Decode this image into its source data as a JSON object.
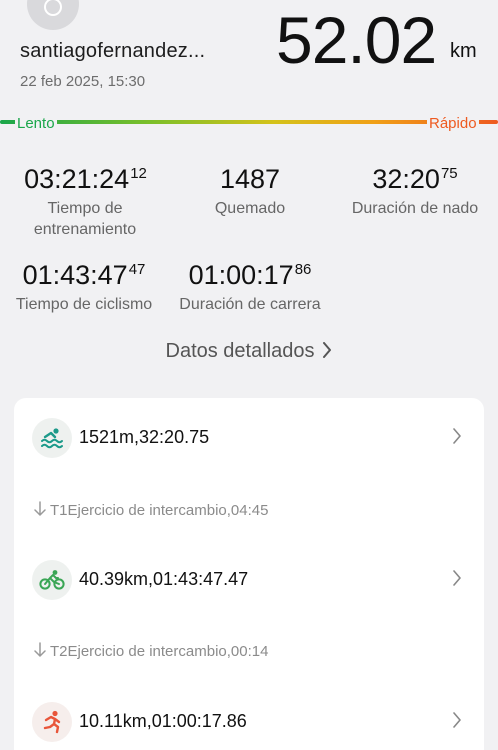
{
  "header": {
    "username": "santiagofernandez...",
    "datetime": "22 feb 2025, 15:30",
    "distance": "52.02",
    "unit": "km"
  },
  "speed_bar": {
    "slow_label": "Lento",
    "fast_label": "Rápido",
    "colors": [
      "#1aa64a",
      "#d4c21a",
      "#ee5a20"
    ]
  },
  "stats": {
    "training_time": {
      "main": "03:21:24",
      "sub": "12",
      "label": "Tiempo de entrenamiento"
    },
    "burned": {
      "main": "1487",
      "label": "Quemado"
    },
    "swim_duration": {
      "main": "32:20",
      "sub": "75",
      "label": "Duración de nado"
    },
    "cycling_time": {
      "main": "01:43:47",
      "sub": "47",
      "label": "Tiempo de ciclismo"
    },
    "run_duration": {
      "main": "01:00:17",
      "sub": "86",
      "label": "Duración de carrera"
    }
  },
  "detailed_link": "Datos detallados",
  "segments": {
    "swim": {
      "text": "1521m,32:20.75",
      "icon": "swim-icon"
    },
    "t1": "T1Ejercicio de intercambio,04:45",
    "bike": {
      "text": "40.39km,01:43:47.47",
      "icon": "bike-icon"
    },
    "t2": "T2Ejercicio de intercambio,00:14",
    "run": {
      "text": "10.11km,01:00:17.86",
      "icon": "run-icon"
    }
  },
  "accent_color": "#1aa64a"
}
